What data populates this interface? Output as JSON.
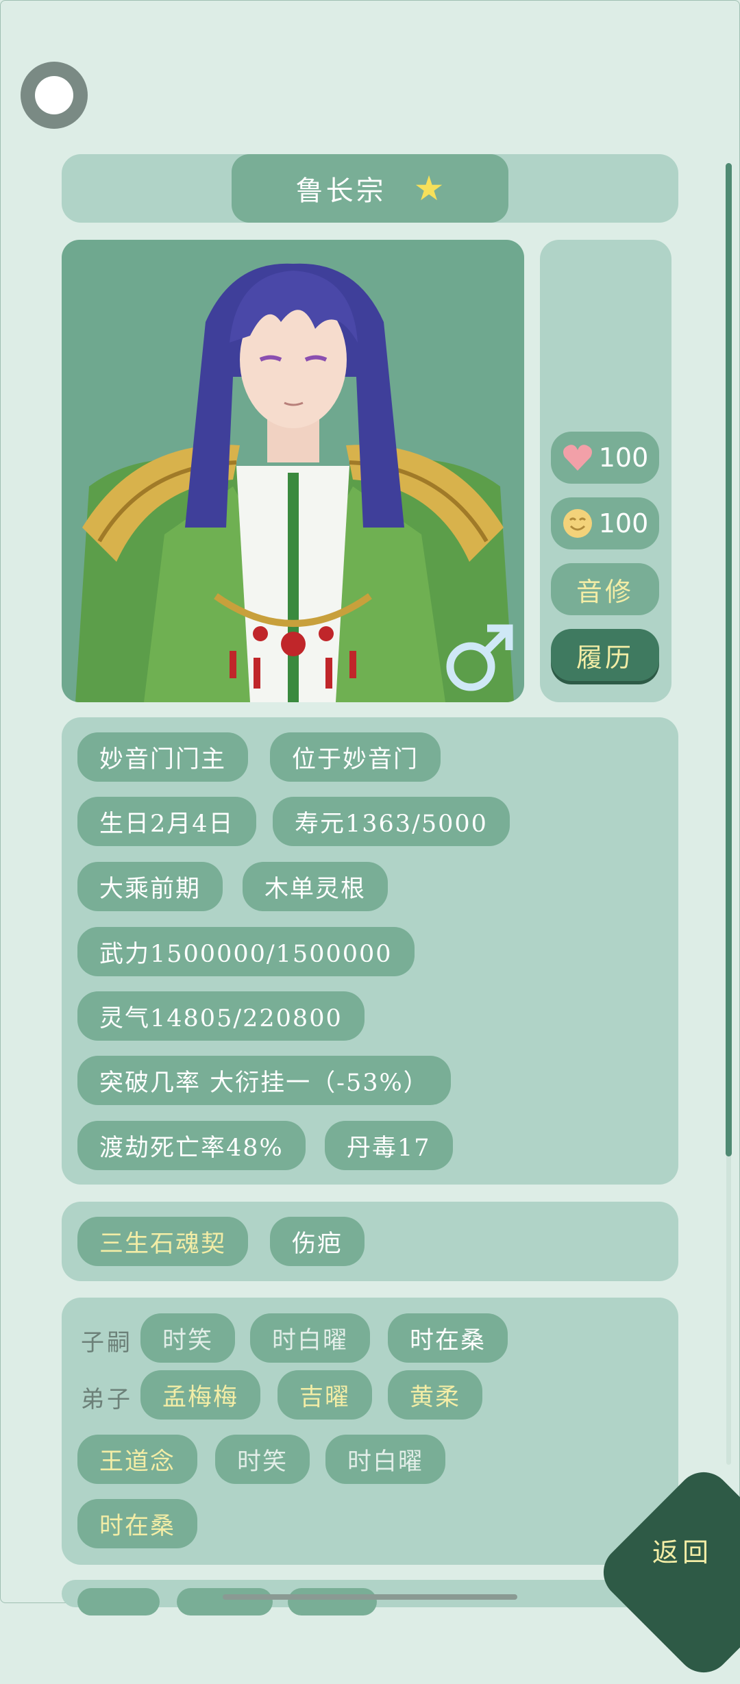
{
  "header": {
    "name": "鲁长宗",
    "star_icon": "star-icon"
  },
  "stats": {
    "heart_value": "100",
    "mood_value": "100"
  },
  "side_buttons": {
    "cultivation": "音修",
    "history": "履历"
  },
  "info_tags": {
    "title": "妙音门门主",
    "location": "位于妙音门",
    "birthday": "生日2月4日",
    "lifespan": "寿元1363/5000",
    "realm": "大乘前期",
    "root": "木单灵根",
    "force": "武力1500000/1500000",
    "qi": "灵气14805/220800",
    "breakthrough": "突破几率 大衍挂一（-53%）",
    "tribulation": "渡劫死亡率48%",
    "poison": "丹毒17"
  },
  "traits": {
    "item1": "三生石魂契",
    "item2": "伤疤"
  },
  "relations": {
    "children_label": "子嗣",
    "children": [
      "时笑",
      "时白曜",
      "时在桑"
    ],
    "disciples_label": "弟子",
    "disciples": [
      "孟梅梅",
      "吉曜",
      "黄柔"
    ],
    "others": [
      "王道念",
      "时笑",
      "时白曜",
      "时在桑"
    ]
  },
  "footer": {
    "back": "返回"
  },
  "colors": {
    "background": "#ddede6",
    "panel": "#b0d3c7",
    "tag": "#79ae96",
    "dark_button": "#3f7a60",
    "accent_yellow": "#f3eda6",
    "star": "#f6e05a",
    "heart": "#f2a0a8"
  }
}
